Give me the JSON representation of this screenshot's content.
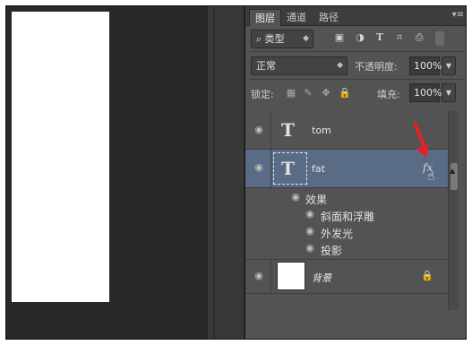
{
  "tabs": [
    {
      "label": "图层",
      "active": true
    },
    {
      "label": "通道",
      "active": false
    },
    {
      "label": "路径",
      "active": false
    }
  ],
  "filter": {
    "kind_label": "类型",
    "icons": [
      "image-filter-icon",
      "adjustment-filter-icon",
      "text-filter-icon",
      "shape-filter-icon",
      "smart-object-filter-icon"
    ]
  },
  "blend": {
    "mode": "正常",
    "opacity_label": "不透明度:",
    "opacity_value": "100%"
  },
  "lock": {
    "label": "锁定:",
    "fill_label": "填充:",
    "fill_value": "100%"
  },
  "layers": [
    {
      "name": "tom",
      "type": "text",
      "selected": false
    },
    {
      "name": "fat",
      "type": "text",
      "selected": true,
      "fx": "fx"
    },
    {
      "name": "背景",
      "type": "background",
      "selected": false,
      "locked": true
    }
  ],
  "effects": {
    "header": "效果",
    "items": [
      "斜面和浮雕",
      "外发光",
      "投影"
    ]
  },
  "colors": {
    "selected_row": "#5a6b86",
    "panel_bg": "#535353",
    "arrow": "#e52020"
  }
}
